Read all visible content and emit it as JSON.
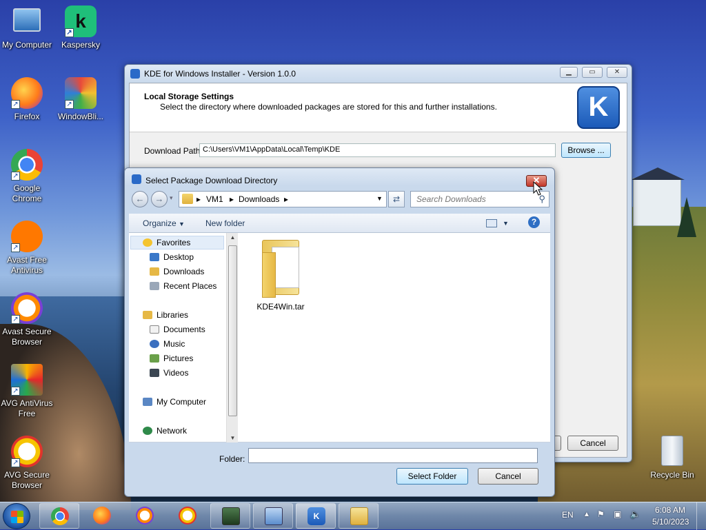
{
  "desktop": {
    "icons": [
      {
        "label": "My Computer"
      },
      {
        "label": "Kaspersky"
      },
      {
        "label": "Firefox"
      },
      {
        "label": "WindowBli..."
      },
      {
        "label": "Google Chrome"
      },
      {
        "label": "Avast Free Antivirus"
      },
      {
        "label": "Avast Secure Browser"
      },
      {
        "label": "AVG AntiVirus Free"
      },
      {
        "label": "AVG Secure Browser"
      },
      {
        "label": "Recycle Bin"
      }
    ]
  },
  "installer": {
    "title": "KDE for Windows Installer - Version 1.0.0",
    "heading": "Local Storage Settings",
    "subheading": "Select the directory where downloaded packages are stored for this and further installations.",
    "download_label": "Download Path",
    "download_path": "C:\\Users\\VM1\\AppData\\Local\\Temp\\KDE",
    "browse_label": "Browse ...",
    "cancel_label": "Cancel",
    "logo_letter": "K"
  },
  "dialog": {
    "title": "Select Package Download Directory",
    "breadcrumb": [
      "VM1",
      "Downloads"
    ],
    "search_placeholder": "Search Downloads",
    "toolbar": {
      "organize": "Organize",
      "new_folder": "New folder"
    },
    "nav": {
      "favorites": "Favorites",
      "fav_items": [
        "Desktop",
        "Downloads",
        "Recent Places"
      ],
      "libraries": "Libraries",
      "lib_items": [
        "Documents",
        "Music",
        "Pictures",
        "Videos"
      ],
      "computer": "My Computer",
      "network": "Network"
    },
    "files": [
      {
        "name": "KDE4Win.tar"
      }
    ],
    "folder_label": "Folder:",
    "folder_value": "",
    "select_label": "Select Folder",
    "cancel_label": "Cancel"
  },
  "taskbar": {
    "language": "EN",
    "time": "6:08 AM",
    "date": "5/10/2023"
  },
  "colors": {
    "accent": "#1b5ab8",
    "close": "#c2372a",
    "taskbar": "#7891b4"
  }
}
